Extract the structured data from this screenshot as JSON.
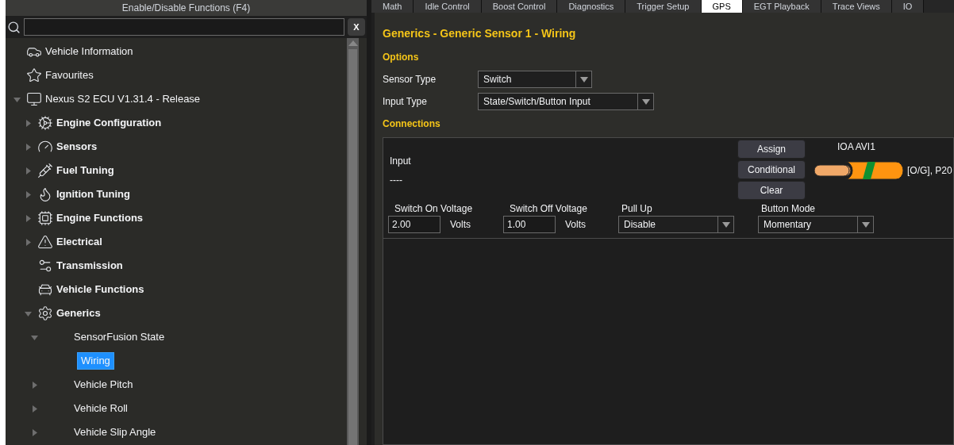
{
  "left_panel": {
    "header": "Enable/Disable Functions (F4)",
    "clear_button": "X",
    "tree": [
      {
        "label": "Vehicle Information",
        "selected": false
      },
      {
        "label": "Favourites",
        "selected": false
      },
      {
        "label": "Nexus S2 ECU V1.31.4 - Release",
        "expanded": true,
        "selected": false,
        "children": [
          {
            "label": "Engine Configuration",
            "expanded": false,
            "selected": false
          },
          {
            "label": "Sensors",
            "expanded": false,
            "selected": false
          },
          {
            "label": "Fuel Tuning",
            "expanded": false,
            "selected": false
          },
          {
            "label": "Ignition Tuning",
            "expanded": false,
            "selected": false
          },
          {
            "label": "Engine Functions",
            "expanded": false,
            "selected": false
          },
          {
            "label": "Electrical",
            "expanded": false,
            "selected": false
          },
          {
            "label": "Transmission",
            "selected": false
          },
          {
            "label": "Vehicle Functions",
            "selected": false
          },
          {
            "label": "Generics",
            "expanded": true,
            "selected": false,
            "children": [
              {
                "label": "SensorFusion State",
                "expanded": true,
                "selected": false,
                "children": [
                  {
                    "label": "Wiring",
                    "selected": true
                  }
                ]
              },
              {
                "label": "Vehicle Pitch",
                "expanded": false,
                "selected": false
              },
              {
                "label": "Vehicle Roll",
                "expanded": false,
                "selected": false
              },
              {
                "label": "Vehicle Slip Angle",
                "expanded": false,
                "selected": false
              }
            ]
          }
        ]
      }
    ]
  },
  "tabs": [
    {
      "label": "Math",
      "selected": false
    },
    {
      "label": "Idle Control",
      "selected": false
    },
    {
      "label": "Boost Control",
      "selected": false
    },
    {
      "label": "Diagnostics",
      "selected": false
    },
    {
      "label": "Trigger Setup",
      "selected": false
    },
    {
      "label": "GPS",
      "selected": true
    },
    {
      "label": "EGT Playback",
      "selected": false
    },
    {
      "label": "Trace Views",
      "selected": false
    },
    {
      "label": "IO",
      "selected": false
    }
  ],
  "content": {
    "title": "Generics - Generic Sensor 1 - Wiring",
    "options_heading": "Options",
    "options": [
      {
        "label": "Sensor Type",
        "value": "Switch",
        "wide": false
      },
      {
        "label": "Input Type",
        "value": "State/Switch/Button Input",
        "wide": true
      }
    ],
    "connections_heading": "Connections",
    "connection": {
      "input_label": "Input",
      "input_value": "----",
      "buttons": [
        "Assign",
        "Conditional",
        "Clear"
      ],
      "pin_name": "IOA AVI1",
      "wire_label": "[O/G], P20",
      "settings": [
        {
          "kind": "number",
          "label": "Switch On Voltage",
          "value": "2.00",
          "unit": "Volts"
        },
        {
          "kind": "number",
          "label": "Switch Off Voltage",
          "value": "1.00",
          "unit": "Volts"
        },
        {
          "kind": "dropdown",
          "label": "Pull Up",
          "value": "Disable"
        },
        {
          "kind": "dropdown",
          "label": "Button Mode",
          "value": "Momentary"
        }
      ]
    }
  }
}
